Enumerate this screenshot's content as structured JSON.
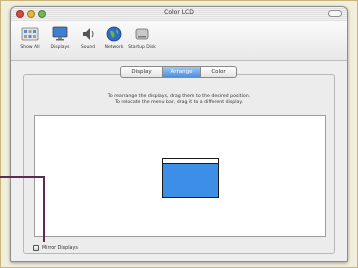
{
  "window": {
    "title": "Color LCD"
  },
  "toolbar": {
    "items": [
      {
        "label": "Show All",
        "icon": "show-all-icon"
      },
      {
        "label": "Displays",
        "icon": "display-icon"
      },
      {
        "label": "Sound",
        "icon": "speaker-icon"
      },
      {
        "label": "Network",
        "icon": "network-globe-icon"
      },
      {
        "label": "Startup Disk",
        "icon": "disk-icon"
      }
    ]
  },
  "tabs": [
    {
      "label": "Display",
      "selected": false
    },
    {
      "label": "Arrange",
      "selected": true
    },
    {
      "label": "Color",
      "selected": false
    }
  ],
  "instructions": {
    "line1": "To rearrange the displays, drag them to the desired position.",
    "line2": "To relocate the menu bar, drag it to a different display."
  },
  "mirror": {
    "label": "Mirror Displays",
    "checked": false
  },
  "colors": {
    "display_blue": "#3d8ee6",
    "callout": "#5b2a55",
    "tab_selected": "#4d8fd8"
  }
}
